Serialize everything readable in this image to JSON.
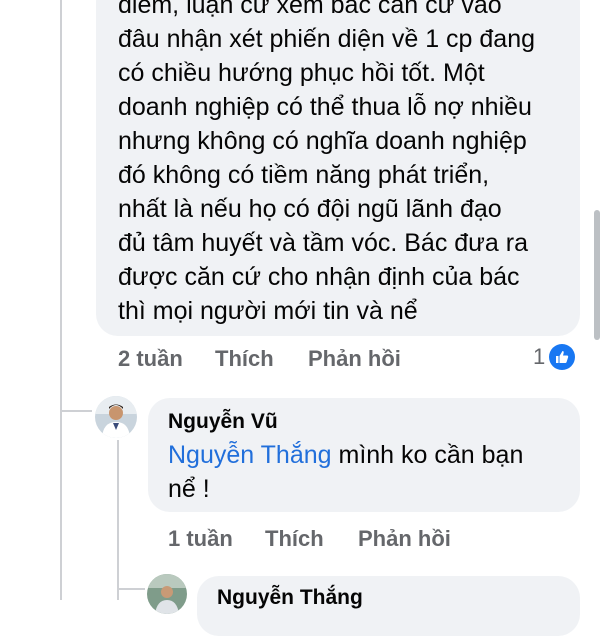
{
  "comment1": {
    "lines": [
      "điểm, luận cứ xem bác căn cứ vào",
      "đâu nhận xét phiến diện về 1 cp đang",
      "có chiều hướng phục hồi tốt. Một",
      "doanh nghiệp có thể thua lỗ nợ nhiều",
      "nhưng không có nghĩa doanh nghiệp",
      "đó không có tiềm năng phát triển,",
      "nhất là nếu họ có đội ngũ lãnh đạo",
      "đủ tâm huyết và tầm vóc. Bác đưa ra",
      "được căn cứ cho nhận định của bác",
      "thì mọi người mới tin và nể"
    ],
    "time": "2 tuần",
    "like_label": "Thích",
    "reply_label": "Phản hồi",
    "reaction_count": "1",
    "reaction_icon": "like-icon"
  },
  "comment2": {
    "author": "Nguyễn Vũ",
    "mention": "Nguyễn Thắng",
    "text_line1_rest": " mình ko cần bạn",
    "text_line2": "nể !",
    "time": "1 tuần",
    "like_label": "Thích",
    "reply_label": "Phản hồi"
  },
  "comment3": {
    "author": "Nguyễn Thắng"
  },
  "colors": {
    "bubble": "#f0f2f5",
    "mention": "#216fdb",
    "action_text": "#65676b",
    "like_blue": "#1877f2"
  }
}
